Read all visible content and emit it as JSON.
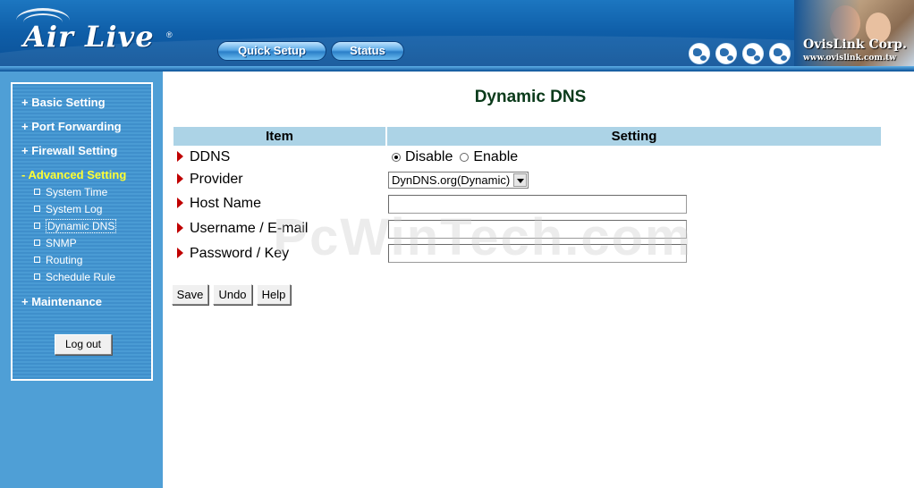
{
  "header": {
    "logo_text": "Air Live",
    "logo_mark": "®",
    "nav": [
      {
        "label": "Quick Setup"
      },
      {
        "label": "Status"
      }
    ],
    "corp_name": "OvisLink Corp.",
    "corp_url": "www.ovislink.com.tw",
    "icons": [
      "globe-icon",
      "globe-icon",
      "globe-icon",
      "globe-icon"
    ]
  },
  "sidebar": {
    "items": [
      {
        "label": "+ Basic Setting",
        "active": false
      },
      {
        "label": "+ Port Forwarding",
        "active": false
      },
      {
        "label": "+ Firewall Setting",
        "active": false
      },
      {
        "label": "- Advanced Setting",
        "active": true
      },
      {
        "label": "+ Maintenance",
        "active": false
      }
    ],
    "sub_items": [
      {
        "label": "System Time"
      },
      {
        "label": "System Log"
      },
      {
        "label": "Dynamic DNS",
        "current": true
      },
      {
        "label": "SNMP"
      },
      {
        "label": "Routing"
      },
      {
        "label": "Schedule Rule"
      }
    ],
    "logout_label": "Log out"
  },
  "main": {
    "title": "Dynamic DNS",
    "watermark": "PcWinTech.com",
    "table": {
      "headers": [
        "Item",
        "Setting"
      ],
      "rows": [
        {
          "label": "DDNS"
        },
        {
          "label": "Provider"
        },
        {
          "label": "Host Name"
        },
        {
          "label": "Username / E-mail"
        },
        {
          "label": "Password / Key"
        }
      ]
    },
    "ddns": {
      "options": [
        "Disable",
        "Enable"
      ],
      "selected": "Disable"
    },
    "provider": {
      "selected": "DynDNS.org(Dynamic)"
    },
    "host_name": {
      "value": ""
    },
    "username": {
      "value": ""
    },
    "password": {
      "value": ""
    },
    "buttons": {
      "save": "Save",
      "undo": "Undo",
      "help": "Help"
    }
  }
}
